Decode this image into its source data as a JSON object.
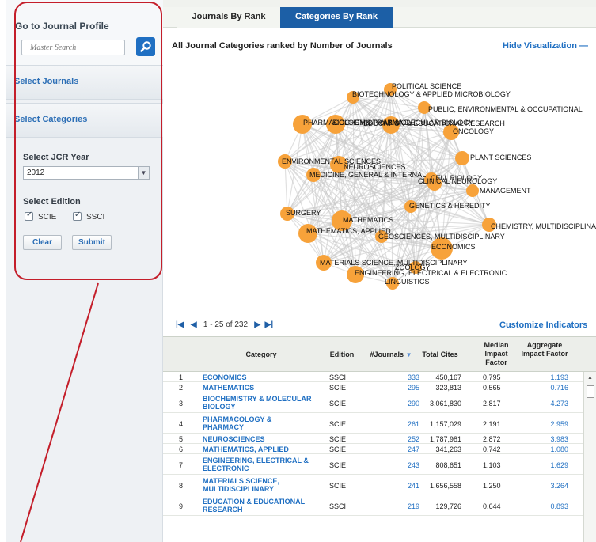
{
  "sidebar": {
    "profile_title": "Go to Journal Profile",
    "search_placeholder": "Master Search",
    "select_journals": "Select Journals",
    "select_categories": "Select Categories",
    "jcr_year_label": "Select JCR Year",
    "jcr_year_value": "2012",
    "edition_label": "Select Edition",
    "edition_scie": "SCIE",
    "edition_ssci": "SSCI",
    "clear_label": "Clear",
    "submit_label": "Submit",
    "highlight_color": "#c41e2a"
  },
  "tabs": {
    "journals_by_rank": "Journals By Rank",
    "categories_by_rank": "Categories By Rank"
  },
  "main": {
    "heading": "All Journal Categories ranked by Number of Journals",
    "hide_visualization": "Hide Visualization",
    "customize_indicators": "Customize Indicators",
    "pager_text": "1 - 25 of 232",
    "accent": "#1f6fc2",
    "node_color": "#f7a23a"
  },
  "network": {
    "nodes": [
      "POLITICAL SCIENCE",
      "BIOTECHNOLOGY & APPLIED MICROBIOLOGY",
      "PUBLIC, ENVIRONMENTAL & OCCUPATIONAL",
      "PHARMACOLOGY & PHARMACY",
      "BIOCHEMISTRY & MOLECULAR BIOLOGY",
      "EDUCATION & EDUCATIONAL RESEARCH",
      "ONCOLOGY",
      "ENVIRONMENTAL SCIENCES",
      "NEUROSCIENCES",
      "CLINICAL NEUROLOGY",
      "PLANT SCIENCES",
      "MEDICINE, GENERAL & INTERNAL",
      "CELL BIOLOGY",
      "MANAGEMENT",
      "GENETICS & HEREDITY",
      "SURGERY",
      "MATHEMATICS",
      "CHEMISTRY, MULTIDISCIPLINARY",
      "MATHEMATICS, APPLIED",
      "GEOSCIENCES, MULTIDISCIPLINARY",
      "ECONOMICS",
      "MATERIALS SCIENCE, MULTIDISCIPLINARY",
      "ZOOLOGY",
      "ENGINEERING, ELECTRICAL & ELECTRONIC",
      "LINGUISTICS"
    ]
  },
  "table": {
    "headers": {
      "category": "Category",
      "edition": "Edition",
      "journals": "#Journals",
      "total_cites": "Total Cites",
      "median": "Median Impact Factor",
      "aggregate": "Aggregate Impact Factor"
    },
    "rows": [
      {
        "rank": "1",
        "category": "ECONOMICS",
        "edition": "SSCI",
        "journals": "333",
        "cites": "450,167",
        "median": "0.795",
        "aggregate": "1.193"
      },
      {
        "rank": "2",
        "category": "MATHEMATICS",
        "edition": "SCIE",
        "journals": "295",
        "cites": "323,813",
        "median": "0.565",
        "aggregate": "0.716"
      },
      {
        "rank": "3",
        "category": "BIOCHEMISTRY & MOLECULAR BIOLOGY",
        "edition": "SCIE",
        "journals": "290",
        "cites": "3,061,830",
        "median": "2.817",
        "aggregate": "4.273"
      },
      {
        "rank": "4",
        "category": "PHARMACOLOGY & PHARMACY",
        "edition": "SCIE",
        "journals": "261",
        "cites": "1,157,029",
        "median": "2.191",
        "aggregate": "2.959"
      },
      {
        "rank": "5",
        "category": "NEUROSCIENCES",
        "edition": "SCIE",
        "journals": "252",
        "cites": "1,787,981",
        "median": "2.872",
        "aggregate": "3.983"
      },
      {
        "rank": "6",
        "category": "MATHEMATICS, APPLIED",
        "edition": "SCIE",
        "journals": "247",
        "cites": "341,263",
        "median": "0.742",
        "aggregate": "1.080"
      },
      {
        "rank": "7",
        "category": "ENGINEERING, ELECTRICAL & ELECTRONIC",
        "edition": "SCIE",
        "journals": "243",
        "cites": "808,651",
        "median": "1.103",
        "aggregate": "1.629"
      },
      {
        "rank": "8",
        "category": "MATERIALS SCIENCE, MULTIDISCIPLINARY",
        "edition": "SCIE",
        "journals": "241",
        "cites": "1,656,558",
        "median": "1.250",
        "aggregate": "3.264"
      },
      {
        "rank": "9",
        "category": "EDUCATION & EDUCATIONAL RESEARCH",
        "edition": "SSCI",
        "journals": "219",
        "cites": "129,726",
        "median": "0.644",
        "aggregate": "0.893"
      }
    ]
  }
}
